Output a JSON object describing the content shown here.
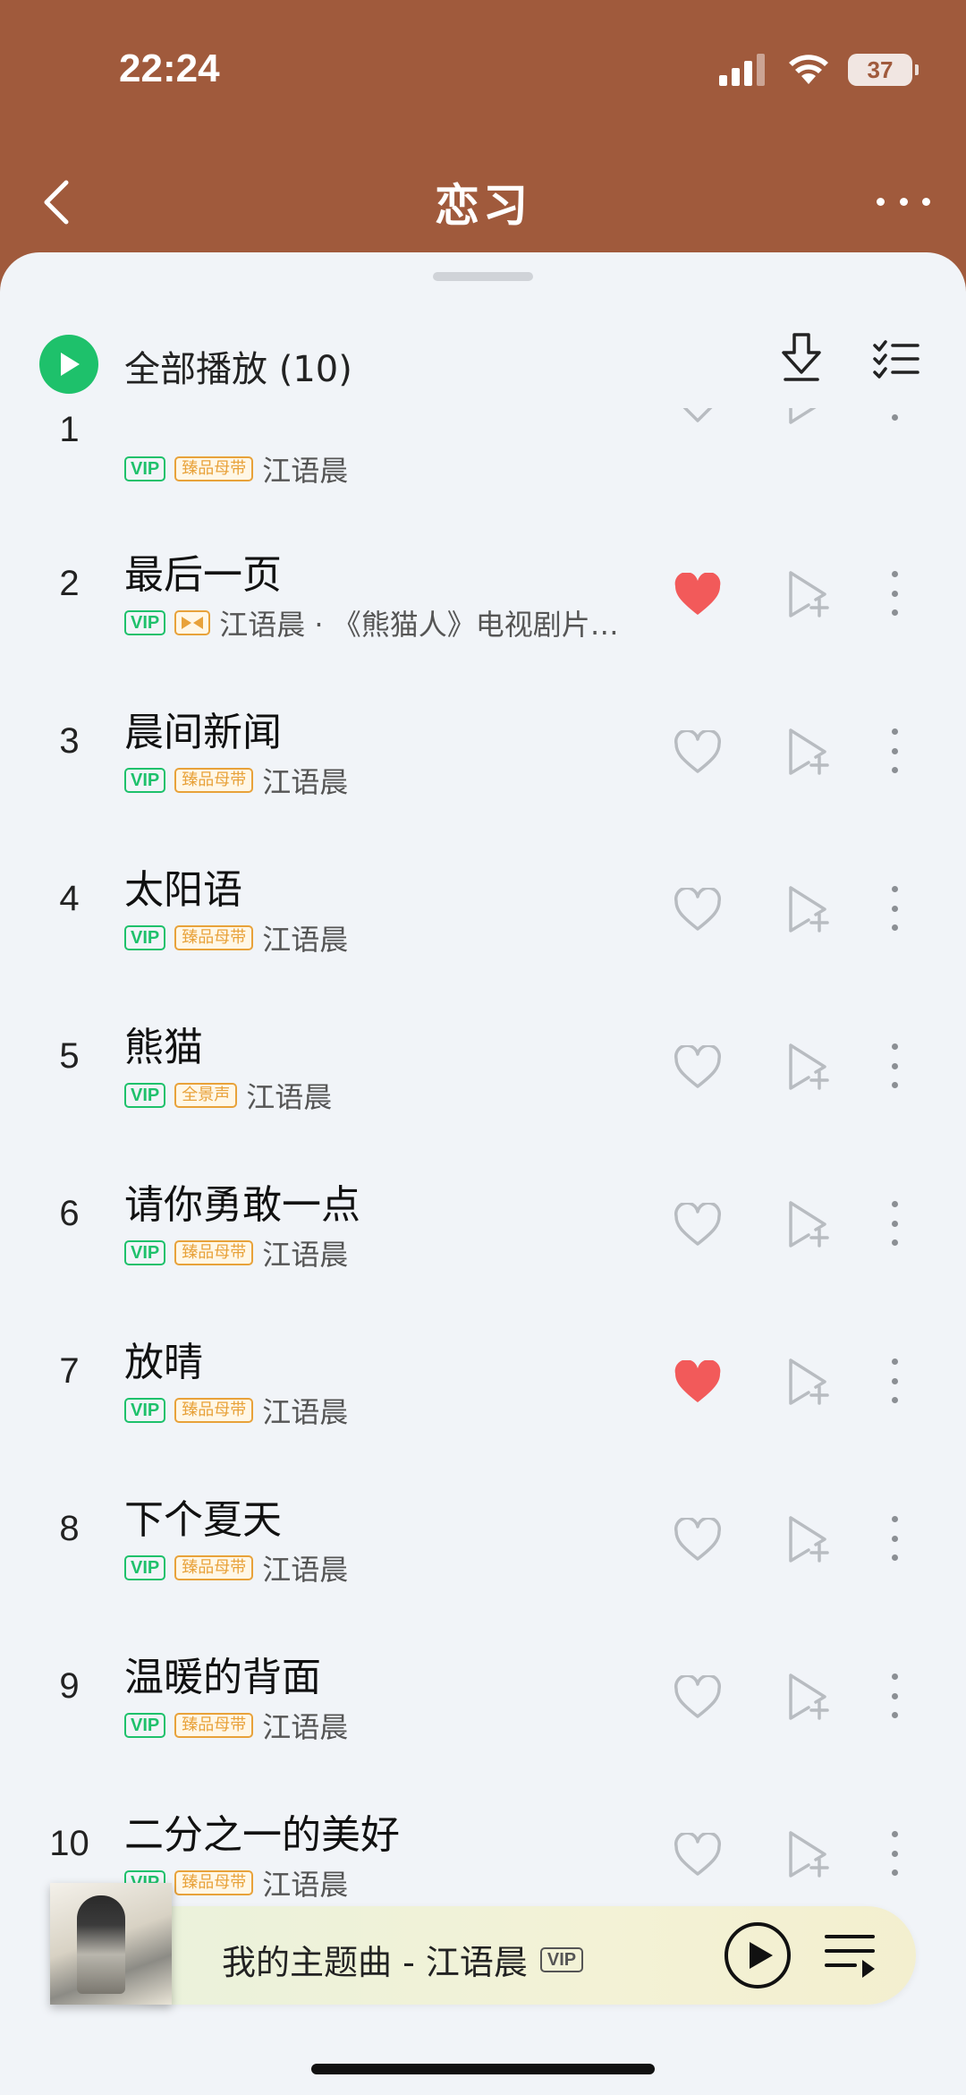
{
  "status_bar": {
    "time": "22:24",
    "battery": "37"
  },
  "nav": {
    "title": "恋习"
  },
  "header": {
    "play_all_label": "全部播放 (10)"
  },
  "songs": [
    {
      "num": "1",
      "title": "",
      "artist": "江语晨",
      "quality": "臻品母带",
      "liked": false
    },
    {
      "num": "2",
      "title": "最后一页",
      "artist": "江语晨 · 《熊猫人》电视剧片…",
      "quality": "",
      "liked": true
    },
    {
      "num": "3",
      "title": "晨间新闻",
      "artist": "江语晨",
      "quality": "臻品母带",
      "liked": false
    },
    {
      "num": "4",
      "title": "太阳语",
      "artist": "江语晨",
      "quality": "臻品母带",
      "liked": false
    },
    {
      "num": "5",
      "title": "熊猫",
      "artist": "江语晨",
      "quality": "全景声",
      "liked": false
    },
    {
      "num": "6",
      "title": "请你勇敢一点",
      "artist": "江语晨",
      "quality": "臻品母带",
      "liked": false
    },
    {
      "num": "7",
      "title": "放晴",
      "artist": "江语晨",
      "quality": "臻品母带",
      "liked": true
    },
    {
      "num": "8",
      "title": "下个夏天",
      "artist": "江语晨",
      "quality": "臻品母带",
      "liked": false
    },
    {
      "num": "9",
      "title": "温暖的背面",
      "artist": "江语晨",
      "quality": "臻品母带",
      "liked": false
    },
    {
      "num": "10",
      "title": "二分之一的美好",
      "artist": "江语晨",
      "quality": "臻品母带",
      "liked": false
    }
  ],
  "vip_tag": "VIP",
  "player": {
    "song": "我的主题曲 - 江语晨",
    "vip": "VIP"
  },
  "colors": {
    "header_bg": "#a05a3c",
    "accent_green": "#1ec16b",
    "heart_red": "#f25a5a",
    "quality_gold": "#e8a23a"
  }
}
